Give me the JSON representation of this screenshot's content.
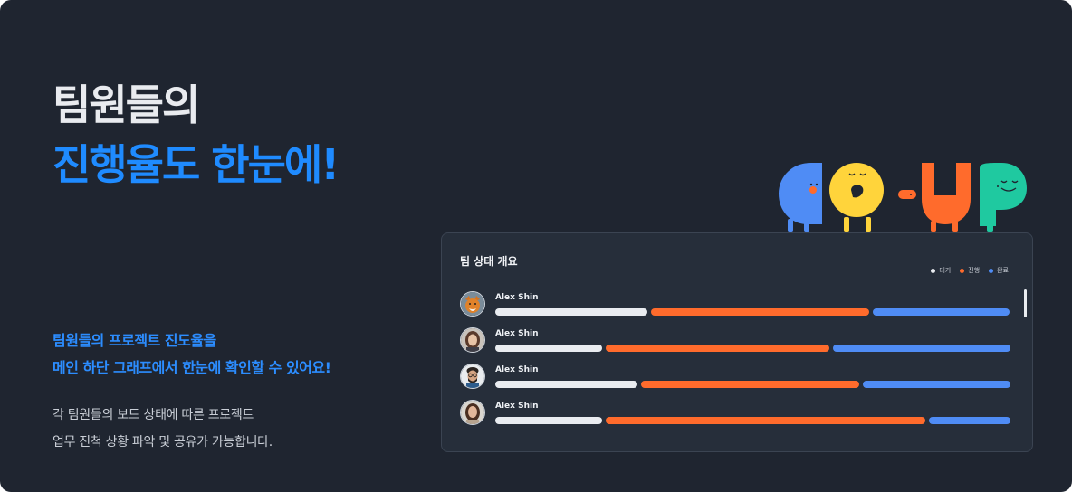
{
  "headline": {
    "line1": "팀원들의",
    "line2": "진행율도 한눈에!"
  },
  "sub": {
    "line1": "팀원들의 프로젝트 진도율을",
    "line2": "메인 하단 그래프에서 한눈에 확인할 수 있어요!"
  },
  "desc": {
    "line1": "각 팀원들의 보드 상태에 따른 프로젝트",
    "line2": "업무 진척 상황 파악 및 공유가 가능합니다."
  },
  "logo": {
    "text": "GO-UP"
  },
  "panel": {
    "title": "팀 상태 개요",
    "legend": [
      {
        "label": "대기",
        "color": "#e9ecf0"
      },
      {
        "label": "진행",
        "color": "#ff6b2c"
      },
      {
        "label": "완료",
        "color": "#4f8cf5"
      }
    ],
    "rows": [
      {
        "name": "Alex Shin",
        "avatar": "fox-avatar",
        "waiting": 0.3,
        "progress": 0.43,
        "done": 0.27
      },
      {
        "name": "Alex Shin",
        "avatar": "woman-avatar",
        "waiting": 0.21,
        "progress": 0.44,
        "done": 0.35
      },
      {
        "name": "Alex Shin",
        "avatar": "man-glasses-avatar",
        "waiting": 0.28,
        "progress": 0.43,
        "done": 0.29
      },
      {
        "name": "Alex Shin",
        "avatar": "woman2-avatar",
        "waiting": 0.21,
        "progress": 0.63,
        "done": 0.16
      }
    ]
  }
}
